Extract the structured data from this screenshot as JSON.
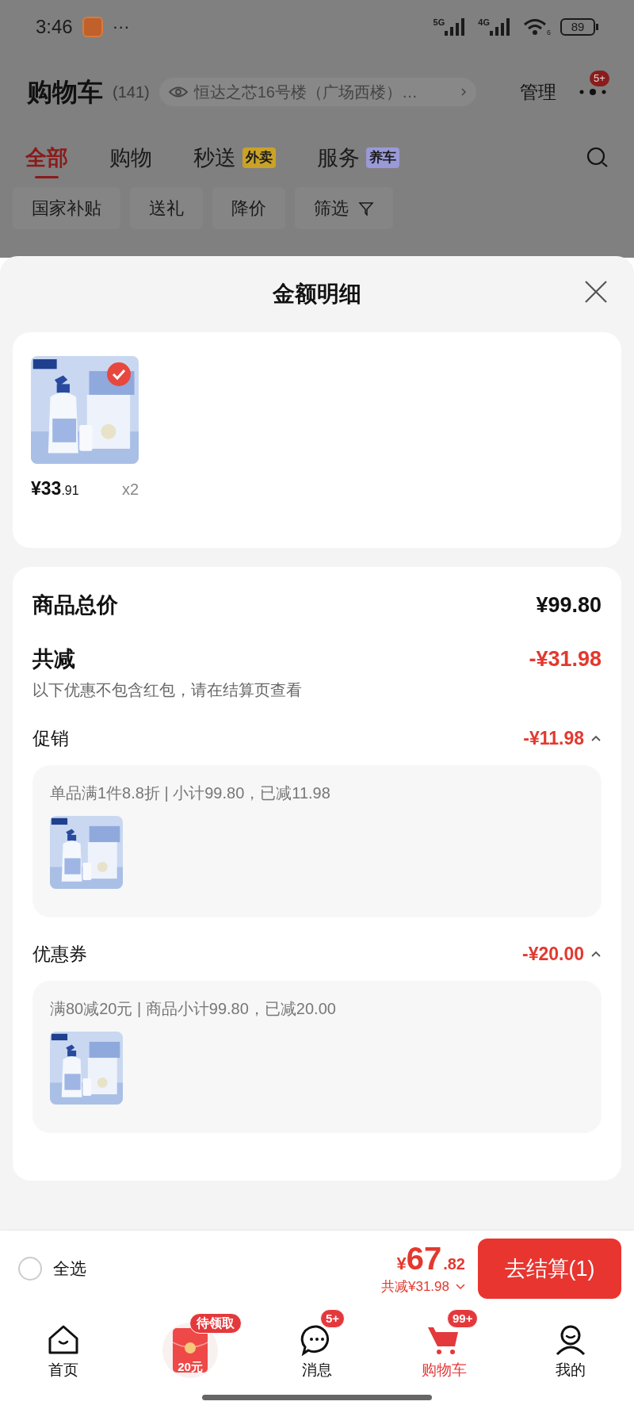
{
  "status_bar": {
    "time": "3:46",
    "dots": "···",
    "net_1": "5G",
    "net_2": "4G",
    "wifi_sub": "6",
    "battery": "89"
  },
  "header": {
    "title": "购物车",
    "count": "(141)",
    "address": "恒达之芯16号楼（广场西楼）…",
    "manage": "管理",
    "more_badge": "5+"
  },
  "tabs": [
    {
      "label": "全部",
      "selected": true
    },
    {
      "label": "购物",
      "selected": false
    },
    {
      "label": "秒送",
      "selected": false,
      "tag": "外卖",
      "color": "#c9a227"
    },
    {
      "label": "服务",
      "selected": false,
      "tag": "养车",
      "color": "#9a9ad8"
    }
  ],
  "filters": [
    {
      "label": "国家补贴",
      "kind": "plain"
    },
    {
      "label": "送礼",
      "kind": "plain"
    },
    {
      "label": "降价",
      "kind": "plain"
    },
    {
      "label": "筛选",
      "kind": "filter"
    }
  ],
  "sheet": {
    "title": "金额明细"
  },
  "items": [
    {
      "price_main": "¥33",
      "price_decimal": ".91",
      "quantity": "x2",
      "selected": true
    }
  ],
  "summary": {
    "total_label": "商品总价",
    "total": "¥99.80",
    "discount_label": "共减",
    "discount": "-¥31.98",
    "note": "以下优惠不包含红包，请在结算页查看"
  },
  "discounts": [
    {
      "label": "促销",
      "amount": "-¥11.98",
      "expanded": true,
      "detail": "单品满1件8.8折 | 小计99.80，已减11.98"
    },
    {
      "label": "优惠券",
      "amount": "-¥20.00",
      "expanded": true,
      "detail": "满80减20元 | 商品小计99.80，已减20.00"
    }
  ],
  "checkout": {
    "select_all": "全选",
    "checked": false,
    "currency": "¥",
    "total_main": "67",
    "total_decimal": ".82",
    "discount": "共减¥31.98",
    "button": "去结算(1)"
  },
  "nav": [
    {
      "kind": "home",
      "label": "首页",
      "selected": false
    },
    {
      "kind": "redpacket",
      "badge": "待领取",
      "amount": "20元"
    },
    {
      "kind": "message",
      "label": "消息",
      "badge": "5+",
      "selected": false
    },
    {
      "kind": "cart",
      "label": "购物车",
      "badge": "99+",
      "selected": true
    },
    {
      "kind": "me",
      "label": "我的",
      "selected": false
    }
  ]
}
